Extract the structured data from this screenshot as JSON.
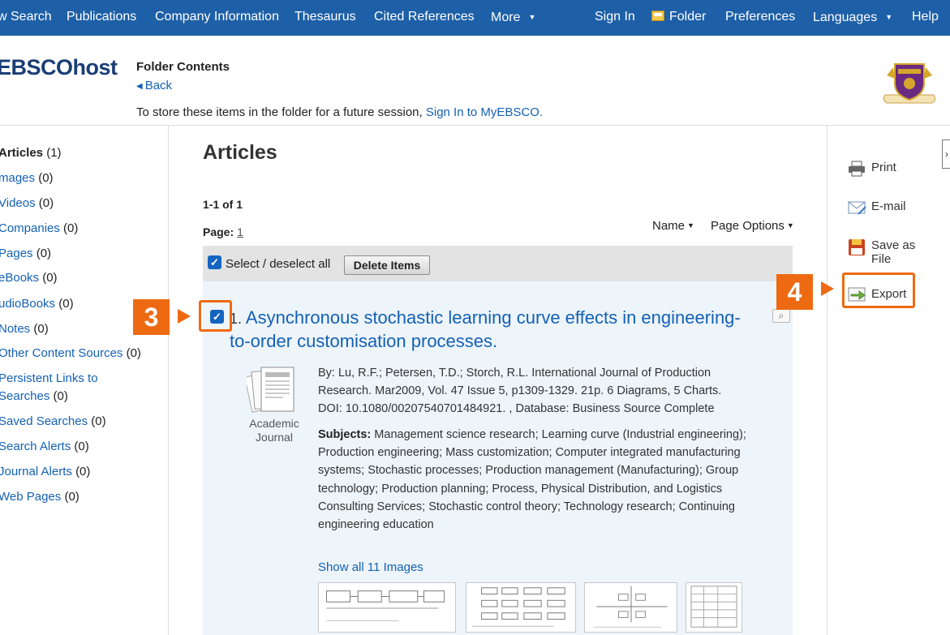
{
  "topnav": {
    "items": [
      "w Search",
      "Publications",
      "Company Information",
      "Thesaurus",
      "Cited References",
      "More",
      "Sign In",
      "Folder",
      "Preferences",
      "Languages",
      "Help"
    ]
  },
  "header": {
    "logo": "EBSCOhost",
    "folder_title": "Folder Contents",
    "back": "Back",
    "store_note": "To store these items in the folder for a future session,",
    "sign_in_link": "Sign In to MyEBSCO."
  },
  "sidebar": {
    "items": [
      {
        "label": "Articles",
        "count": "(1)"
      },
      {
        "label": "mages",
        "count": "(0)"
      },
      {
        "label": "Videos",
        "count": "(0)"
      },
      {
        "label": "Companies",
        "count": "(0)"
      },
      {
        "label": "Pages",
        "count": "(0)"
      },
      {
        "label": "eBooks",
        "count": "(0)"
      },
      {
        "label": "udioBooks",
        "count": "(0)"
      },
      {
        "label": "Notes",
        "count": "(0)"
      },
      {
        "label": "Other Content Sources",
        "count": "(0)"
      },
      {
        "label": "Persistent Links to",
        "count": ""
      },
      {
        "label": "Searches",
        "count": "(0)"
      },
      {
        "label": "Saved Searches",
        "count": "(0)"
      },
      {
        "label": "Search Alerts",
        "count": "(0)"
      },
      {
        "label": "Journal Alerts",
        "count": "(0)"
      },
      {
        "label": "Web Pages",
        "count": "(0)"
      }
    ]
  },
  "main": {
    "heading": "Articles",
    "range": "1-1 of 1",
    "page_label": "Page:",
    "page_num": "1",
    "sort_label": "Name",
    "page_options": "Page Options",
    "select_label": "Select / deselect all",
    "delete_label": "Delete Items",
    "result": {
      "number": "1.",
      "title": "Asynchronous stochastic learning curve effects in engineering-to-order customisation processes.",
      "pubtype": "Academic Journal",
      "meta": "By: Lu, R.F.; Petersen, T.D.; Storch, R.L. International Journal of Production Research. Mar2009, Vol. 47 Issue 5, p1309-1329. 21p. 6 Diagrams, 5 Charts. DOI: 10.1080/00207540701484921. , Database: Business Source Complete",
      "subjects_label": "Subjects:",
      "subjects": "Management science research; Learning curve (Industrial engineering); Production engineering; Mass customization; Computer integrated manufacturing systems; Stochastic processes; Production management (Manufacturing); Group technology; Production planning; Process, Physical Distribution, and Logistics Consulting Services; Stochastic control theory; Technology research; Continuing engineering education",
      "show_images": "Show all 11 Images"
    }
  },
  "tools": {
    "print": "Print",
    "email": "E-mail",
    "save_line1": "Save as",
    "save_line2": "File",
    "export": "Export"
  },
  "annotations": {
    "step3": "3",
    "step4": "4",
    "color": "#ee6a12"
  }
}
